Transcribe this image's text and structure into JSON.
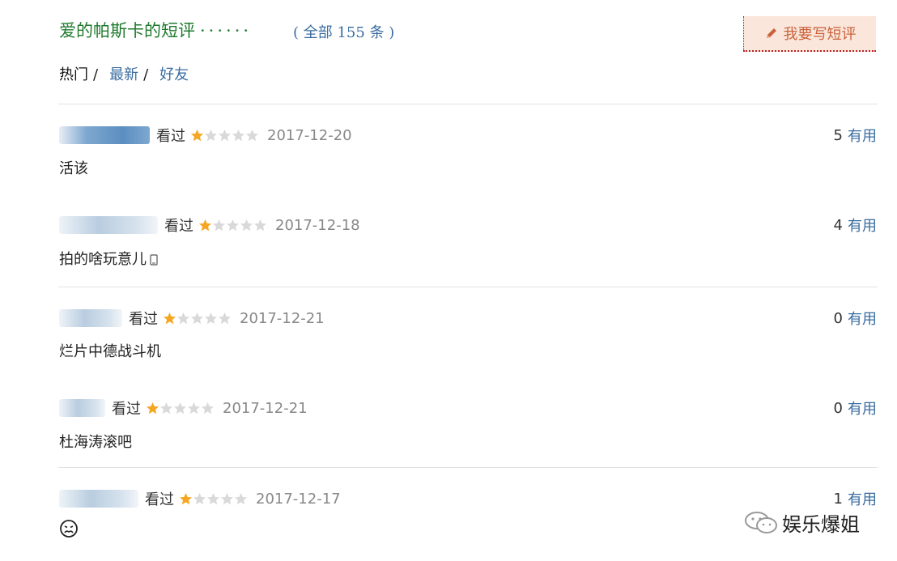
{
  "header": {
    "title": "爱的帕斯卡的短评",
    "dots": "······",
    "count_prefix": "( 全部",
    "count": "155",
    "count_suffix": "条 )",
    "write_button": "我要写短评"
  },
  "tabs": [
    {
      "label": "热门",
      "active": true
    },
    {
      "label": "最新",
      "active": false
    },
    {
      "label": "好友",
      "active": false
    }
  ],
  "tab_separator": "/",
  "reviews": [
    {
      "user": "",
      "watched": "看过",
      "rating": 1,
      "max_rating": 5,
      "date": "2017-12-20",
      "useful_count": "5",
      "useful_label": "有用",
      "comment": "活该"
    },
    {
      "user": "",
      "watched": "看过",
      "rating": 1,
      "max_rating": 5,
      "date": "2017-12-18",
      "useful_count": "4",
      "useful_label": "有用",
      "comment": "拍的啥玩意儿"
    },
    {
      "user": "",
      "watched": "看过",
      "rating": 1,
      "max_rating": 5,
      "date": "2017-12-21",
      "useful_count": "0",
      "useful_label": "有用",
      "comment": "烂片中德战斗机"
    },
    {
      "user": "",
      "watched": "看过",
      "rating": 1,
      "max_rating": 5,
      "date": "2017-12-21",
      "useful_count": "0",
      "useful_label": "有用",
      "comment": "杜海涛滚吧"
    },
    {
      "user": "",
      "watched": "看过",
      "rating": 1,
      "max_rating": 5,
      "date": "2017-12-17",
      "useful_count": "1",
      "useful_label": "有用",
      "comment": ""
    }
  ],
  "watermark": "娱乐爆姐",
  "colors": {
    "title_green": "#1f7a2e",
    "link_blue": "#3a6da0",
    "star_gold": "#f5a623",
    "star_empty": "#d9d9d9",
    "button_bg": "#fbe6dc"
  },
  "icons": [
    "pencil-icon",
    "star-icon",
    "phone-icon",
    "frown-emoji-icon",
    "wechat-icon"
  ]
}
